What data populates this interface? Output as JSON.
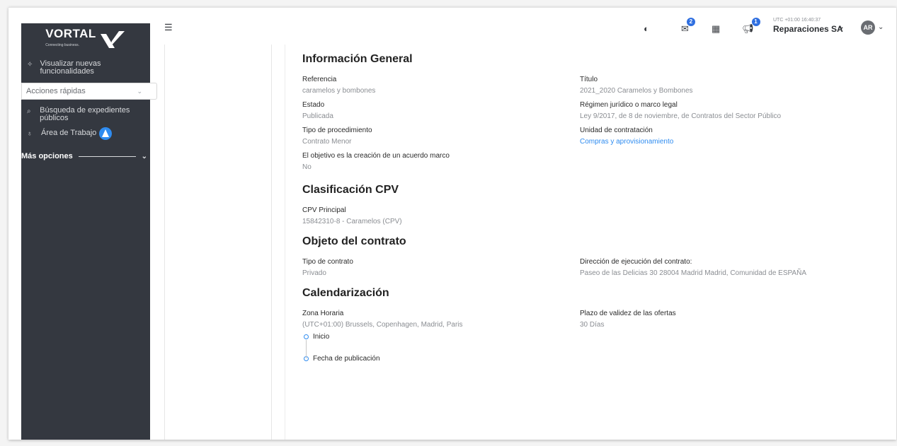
{
  "brand": {
    "name": "VORTAL",
    "tagline": "Connecting business."
  },
  "sidebar": {
    "items": [
      {
        "label": "Visualizar nuevas funcionalidades",
        "icon": "sparkle-icon"
      },
      {
        "label": "Búsqueda de expedientes públicos",
        "icon": "search-doc-icon"
      },
      {
        "label": "Área de Trabajo",
        "icon": "workspace-icon"
      }
    ],
    "quick_actions": "Acciones rápidas",
    "more_options": "Más opciones"
  },
  "topbar": {
    "messages_badge": "2",
    "announcements_badge": "1",
    "timezone_text": "UTC +01:00 16:40:37",
    "company": "Reparaciones SA",
    "avatar": "AR"
  },
  "general": {
    "title": "Información General",
    "referencia_label": "Referencia",
    "referencia_value": "caramelos y bombones",
    "titulo_label": "Título",
    "titulo_value": "2021_2020 Caramelos y Bombones",
    "estado_label": "Estado",
    "estado_value": "Publicada",
    "regimen_label": "Régimen jurídico o marco legal",
    "regimen_value": "Ley 9/2017, de 8 de noviembre, de Contratos del Sector Público",
    "procedimiento_label": "Tipo de procedimiento",
    "procedimiento_value": "Contrato Menor",
    "unidad_label": "Unidad de contratación",
    "unidad_value": "Compras y aprovisionamiento",
    "acuerdo_label": "El objetivo es la creación de un acuerdo marco",
    "acuerdo_value": "No"
  },
  "cpv": {
    "title": "Clasificación CPV",
    "principal_label": "CPV Principal",
    "principal_value": "15842310-8 - Caramelos (CPV)"
  },
  "objeto": {
    "title": "Objeto del contrato",
    "tipo_label": "Tipo de contrato",
    "tipo_value": "Privado",
    "direccion_label": "Dirección de ejecución del contrato:",
    "direccion_value": "Paseo de las Delicias 30 28004 Madrid Madrid, Comunidad de ESPAÑA"
  },
  "calendario": {
    "title": "Calendarización",
    "zona_label": "Zona Horaria",
    "zona_value": "(UTC+01:00) Brussels, Copenhagen, Madrid, Paris",
    "plazo_label": "Plazo de validez de las ofertas",
    "plazo_value": "30 Días",
    "timeline": [
      "Inicio",
      "Fecha de publicación"
    ]
  },
  "colors": {
    "sidebar": "#343840",
    "accent": "#2f8cf0",
    "badge": "#2f6fe0"
  }
}
